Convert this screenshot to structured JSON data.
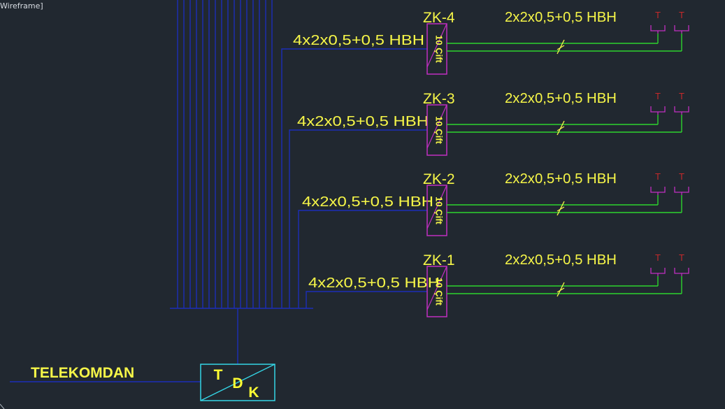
{
  "viewport": {
    "label": "Wireframe]"
  },
  "colors": {
    "background": "#212830",
    "bus": "#1c2db8",
    "cable": "#2dd42d",
    "yellow": "#f6f648",
    "magenta": "#c02fc0",
    "socket_label": "#c42a2a",
    "tdk": "#34d6e6",
    "tdk_text": "#ffff33"
  },
  "risers": [
    {
      "zone_label": "ZK-4",
      "box_label": "10 Çift",
      "feed_label": "4x2x0,5+0,5 HBH",
      "cable_label": "2x2x0,5+0,5 HBH",
      "sockets": [
        "T",
        "T"
      ]
    },
    {
      "zone_label": "ZK-3",
      "box_label": "10 Çift",
      "feed_label": "4x2x0,5+0,5 HBH",
      "cable_label": "2x2x0,5+0,5 HBH",
      "sockets": [
        "T",
        "T"
      ]
    },
    {
      "zone_label": "ZK-2",
      "box_label": "10 Çift",
      "feed_label": "4x2x0,5+0,5 HBH",
      "cable_label": "2x2x0,5+0,5 HBH",
      "sockets": [
        "T",
        "T"
      ]
    },
    {
      "zone_label": "ZK-1",
      "box_label": "10 Çift",
      "feed_label": "4x2x0,5+0,5 HBH",
      "cable_label": "2x2x0,5+0,5 HBH",
      "sockets": [
        "T",
        "T"
      ]
    }
  ],
  "incoming": {
    "label": "TELEKOMDAN"
  },
  "tdk": {
    "letters": [
      "T",
      "D",
      "K"
    ]
  }
}
